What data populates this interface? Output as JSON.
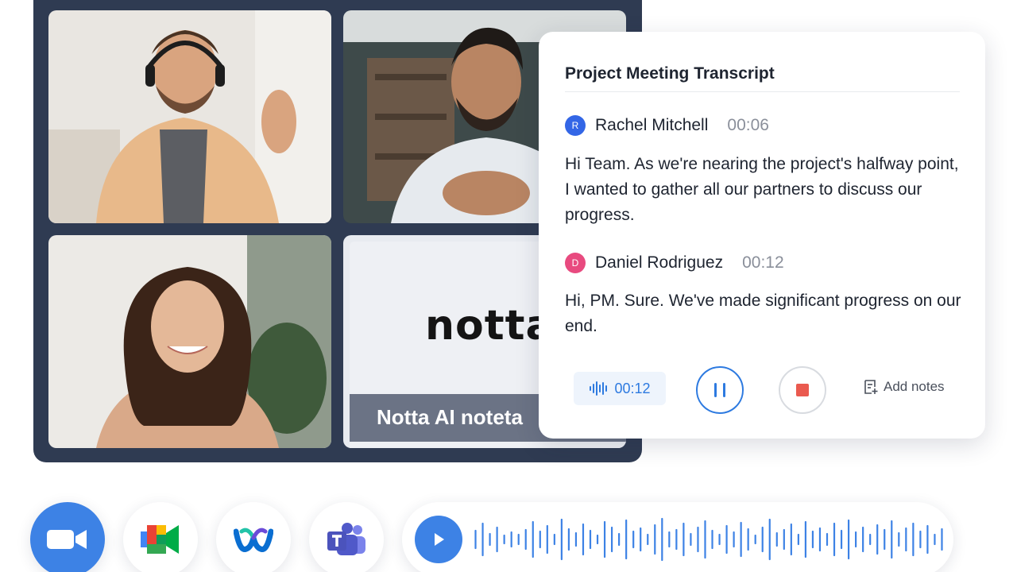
{
  "video_grid": {
    "participants": [
      {
        "id": "participant-1"
      },
      {
        "id": "participant-2"
      },
      {
        "id": "participant-3"
      }
    ],
    "notta_tile": {
      "logo_text": "notta",
      "banner_text": "Notta AI noteta"
    }
  },
  "transcript": {
    "title": "Project Meeting Transcript",
    "entries": [
      {
        "initial": "R",
        "avatar_color": "#3366e6",
        "name": "Rachel Mitchell",
        "time": "00:06",
        "text": "Hi Team. As we're nearing the project's halfway point, I wanted to gather all our partners to discuss our progress."
      },
      {
        "initial": "D",
        "avatar_color": "#e84a7f",
        "name": "Daniel Rodriguez",
        "time": "00:12",
        "text": "Hi, PM. Sure. We've made significant progress on our end."
      }
    ],
    "controls": {
      "timer": "00:12",
      "add_notes_label": "Add notes"
    }
  },
  "integrations": [
    {
      "icon": "zoom-icon"
    },
    {
      "icon": "google-meet-icon"
    },
    {
      "icon": "webex-icon"
    },
    {
      "icon": "microsoft-teams-icon"
    }
  ],
  "colors": {
    "accent": "#2d7ae0",
    "frame": "#2f3b52",
    "stop": "#ea5a4f"
  }
}
